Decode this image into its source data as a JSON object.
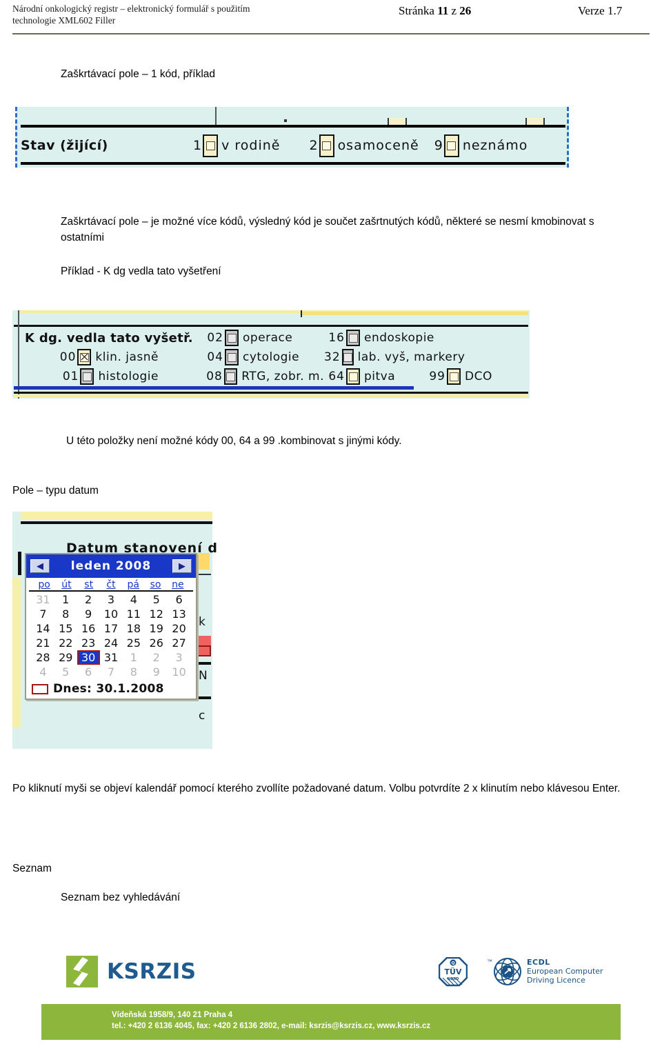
{
  "header": {
    "left_line1": "Národní onkologický registr – elektronický formulář s použitím",
    "left_line2": "technologie XML602 Filler",
    "page_prefix": "Stránka ",
    "page_number": "11",
    "page_of": " z ",
    "page_total": "26",
    "version": "Verze 1.7"
  },
  "body": {
    "heading_checkbox_single": "Zaškrtávací pole –  1 kód, příklad",
    "para_multi_code": "Zaškrtávací pole – je možné více kódů, výsledný kód je součet zašrtnutých kódů, některé se nesmí kmobinovat s ostatními",
    "para_example": "Příklad  - K dg vedla tato vyšetření",
    "para_not_combinable": "U této položky není možné kódy 00, 64 a 99  .kombinovat s jinými kódy.",
    "heading_date_field": "Pole – typu datum",
    "para_calendar": "Po kliknutí myši se objeví kalendář pomocí kterého zvollíte požadované datum. Volbu potvrdíte 2 x klinutím nebo klávesou Enter.",
    "heading_list": "Seznam",
    "heading_list_nosearch": "Seznam  bez vyhledávání"
  },
  "form_stav": {
    "label": "Stav (žijící)",
    "options": [
      {
        "code": "1",
        "text": "v rodině",
        "checked": false
      },
      {
        "code": "2",
        "text": "osamoceně",
        "checked": false
      },
      {
        "code": "9",
        "text": "neznámo",
        "checked": false
      }
    ]
  },
  "form_kdg": {
    "title": "K dg. vedla tato vyšetř.",
    "rows": [
      {
        "col1": null,
        "col2": {
          "code": "02",
          "text": "operace",
          "checked": false,
          "style": "grey"
        },
        "col3": {
          "code": "16",
          "text": "endoskopie",
          "checked": false,
          "style": "grey"
        },
        "col4": null
      },
      {
        "col1": {
          "code": "00",
          "text": "klin. jasně",
          "checked": true,
          "style": "cream"
        },
        "col2": {
          "code": "04",
          "text": "cytologie",
          "checked": false,
          "style": "grey"
        },
        "col3": {
          "code": "32",
          "text": "lab. vyš, markery",
          "checked": false,
          "style": "grey"
        },
        "col4": null
      },
      {
        "col1": {
          "code": "01",
          "text": "histologie",
          "checked": false,
          "style": "grey"
        },
        "col2": {
          "code": "08",
          "text": "RTG, zobr. m.",
          "checked": false,
          "style": "grey"
        },
        "col3": {
          "code": "64",
          "text": "pitva",
          "checked": false,
          "style": "cream"
        },
        "col4": {
          "code": "99",
          "text": "DCO",
          "checked": false,
          "style": "cream"
        }
      }
    ]
  },
  "form_calendar": {
    "field_label": "Datum stanovení d",
    "prev_label": "◀",
    "next_label": "▶",
    "month_year": "leden 2008",
    "day_names": [
      "po",
      "út",
      "st",
      "čt",
      "pá",
      "so",
      "ne"
    ],
    "weeks": [
      [
        {
          "d": "31",
          "t": "dim"
        },
        {
          "d": "1",
          "t": ""
        },
        {
          "d": "2",
          "t": ""
        },
        {
          "d": "3",
          "t": ""
        },
        {
          "d": "4",
          "t": ""
        },
        {
          "d": "5",
          "t": ""
        },
        {
          "d": "6",
          "t": ""
        }
      ],
      [
        {
          "d": "7",
          "t": ""
        },
        {
          "d": "8",
          "t": ""
        },
        {
          "d": "9",
          "t": ""
        },
        {
          "d": "10",
          "t": ""
        },
        {
          "d": "11",
          "t": ""
        },
        {
          "d": "12",
          "t": ""
        },
        {
          "d": "13",
          "t": ""
        }
      ],
      [
        {
          "d": "14",
          "t": ""
        },
        {
          "d": "15",
          "t": ""
        },
        {
          "d": "16",
          "t": ""
        },
        {
          "d": "17",
          "t": ""
        },
        {
          "d": "18",
          "t": ""
        },
        {
          "d": "19",
          "t": ""
        },
        {
          "d": "20",
          "t": ""
        }
      ],
      [
        {
          "d": "21",
          "t": ""
        },
        {
          "d": "22",
          "t": ""
        },
        {
          "d": "23",
          "t": ""
        },
        {
          "d": "24",
          "t": ""
        },
        {
          "d": "25",
          "t": ""
        },
        {
          "d": "26",
          "t": ""
        },
        {
          "d": "27",
          "t": ""
        }
      ],
      [
        {
          "d": "28",
          "t": ""
        },
        {
          "d": "29",
          "t": ""
        },
        {
          "d": "30",
          "t": "sel"
        },
        {
          "d": "31",
          "t": ""
        },
        {
          "d": "1",
          "t": "dim"
        },
        {
          "d": "2",
          "t": "dim"
        },
        {
          "d": "3",
          "t": "dim"
        }
      ],
      [
        {
          "d": "4",
          "t": "dim"
        },
        {
          "d": "5",
          "t": "dim"
        },
        {
          "d": "6",
          "t": "dim"
        },
        {
          "d": "7",
          "t": "dim"
        },
        {
          "d": "8",
          "t": "dim"
        },
        {
          "d": "9",
          "t": "dim"
        },
        {
          "d": "10",
          "t": "dim"
        }
      ]
    ],
    "today_label": "Dnes: 30.1.2008",
    "side_fragments": [
      "k",
      "N",
      "c"
    ]
  },
  "footer": {
    "logo_text": "KSRZIS",
    "ecdl_line1": "ECDL",
    "ecdl_line2": "European Computer",
    "ecdl_line3": "Driving Licence",
    "ecdl_tm": "™",
    "tuv_text": "TÜV",
    "tuv_q": "Q",
    "tuv_sub": "NORD",
    "address_line1": "Vídeňská 1958/9, 140 21 Praha 4",
    "address_line2": "tel.: +420 2 6136 4045, fax: +420 2 6136 2802, e-mail: ksrzis@ksrzis.cz, www.ksrzis.cz"
  },
  "colors": {
    "form_bg": "#dcf0ee",
    "brand_green": "#8cb63c",
    "brand_blue": "#1f5b8f",
    "selection_blue": "#1938c7",
    "selection_red": "#a31717"
  }
}
